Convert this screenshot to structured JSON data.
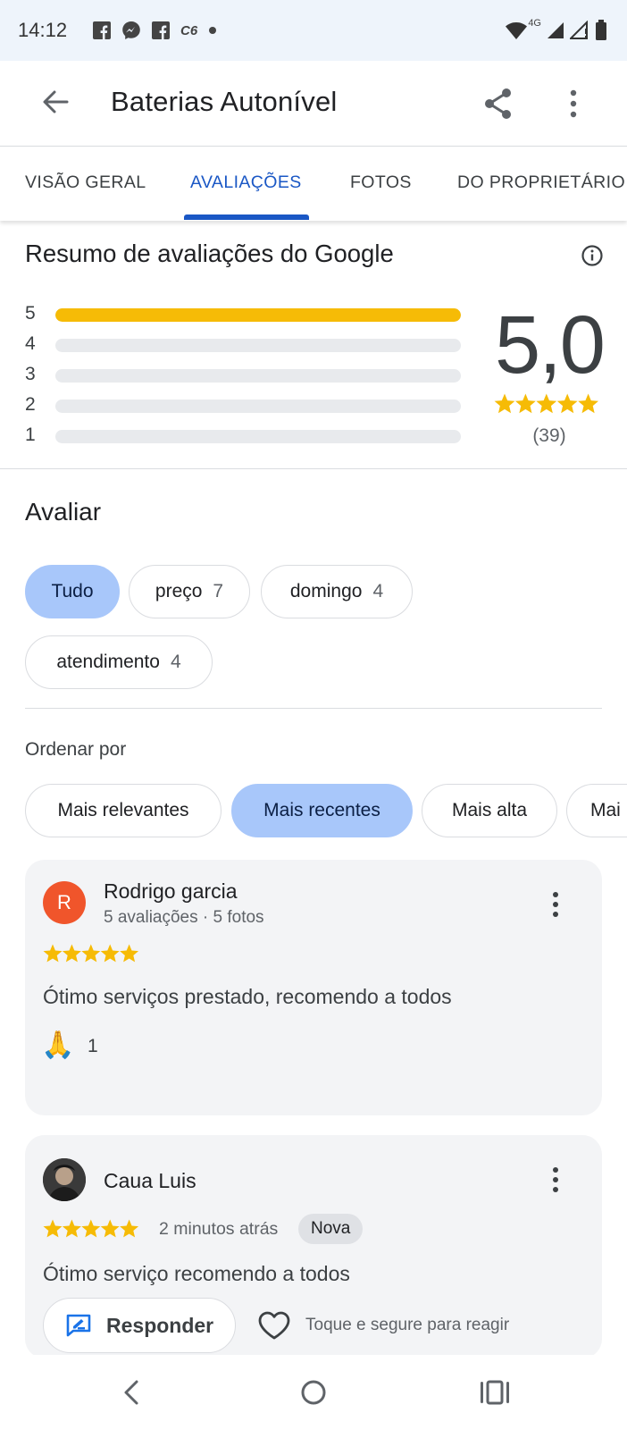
{
  "status_bar": {
    "time": "14:12",
    "left_icons": [
      "facebook-icon",
      "messenger-icon",
      "facebook-icon",
      "c6-icon",
      "dot-icon"
    ],
    "c6_label": "C6",
    "network_label": "4G",
    "right_icons": [
      "wifi-icon",
      "signal-icon",
      "signal-empty-icon",
      "battery-icon"
    ]
  },
  "app_bar": {
    "title": "Baterias Autonível",
    "icons": [
      "back-arrow-icon",
      "share-icon",
      "more-vert-icon"
    ]
  },
  "tabs": [
    {
      "label": "VISÃO GERAL",
      "active": false
    },
    {
      "label": "AVALIAÇÕES",
      "active": true
    },
    {
      "label": "FOTOS",
      "active": false
    },
    {
      "label": "DO PROPRIETÁRIO",
      "active": false
    }
  ],
  "summary": {
    "title": "Resumo de avaliações do Google",
    "distribution": [
      {
        "stars": "5",
        "fraction": 1.0
      },
      {
        "stars": "4",
        "fraction": 0.0
      },
      {
        "stars": "3",
        "fraction": 0.0
      },
      {
        "stars": "2",
        "fraction": 0.0
      },
      {
        "stars": "1",
        "fraction": 0.0
      }
    ],
    "score": "5,0",
    "star_rating": 5,
    "count": "(39)"
  },
  "filter": {
    "title": "Avaliar",
    "chips": [
      {
        "label": "Tudo",
        "count": "",
        "selected": true
      },
      {
        "label": "preço",
        "count": "7",
        "selected": false
      },
      {
        "label": "domingo",
        "count": "4",
        "selected": false
      },
      {
        "label": "atendimento",
        "count": "4",
        "selected": false
      }
    ]
  },
  "sort": {
    "label": "Ordenar por",
    "options": [
      {
        "label": "Mais relevantes",
        "selected": false
      },
      {
        "label": "Mais recentes",
        "selected": true
      },
      {
        "label": "Mais alta",
        "selected": false
      },
      {
        "label": "Mai",
        "selected": false
      }
    ]
  },
  "reviews": [
    {
      "avatar_letter": "R",
      "name": "Rodrigo garcia",
      "meta": "5 avaliações · 5 fotos",
      "rating": 5,
      "text": "Ótimo serviços prestado, recomendo a todos",
      "reaction_emoji": "🙏",
      "reaction_count": "1"
    },
    {
      "avatar_letter": "",
      "name": "Caua Luis",
      "rating": 5,
      "time_ago": "2 minutos atrás",
      "badge": "Nova",
      "text": "Ótimo serviço recomendo a todos",
      "reply_label": "Responder",
      "react_hint": "Toque e segure para reagir"
    }
  ],
  "colors": {
    "accent_blue": "#1a57c5",
    "chip_selected": "#a8c7fa",
    "star_gold": "#f6bb06",
    "avatar_orange": "#f0552b",
    "card_bg": "#f3f4f6"
  },
  "nav_bar": {
    "icons": [
      "nav-back-icon",
      "nav-home-icon",
      "nav-recents-icon"
    ]
  }
}
